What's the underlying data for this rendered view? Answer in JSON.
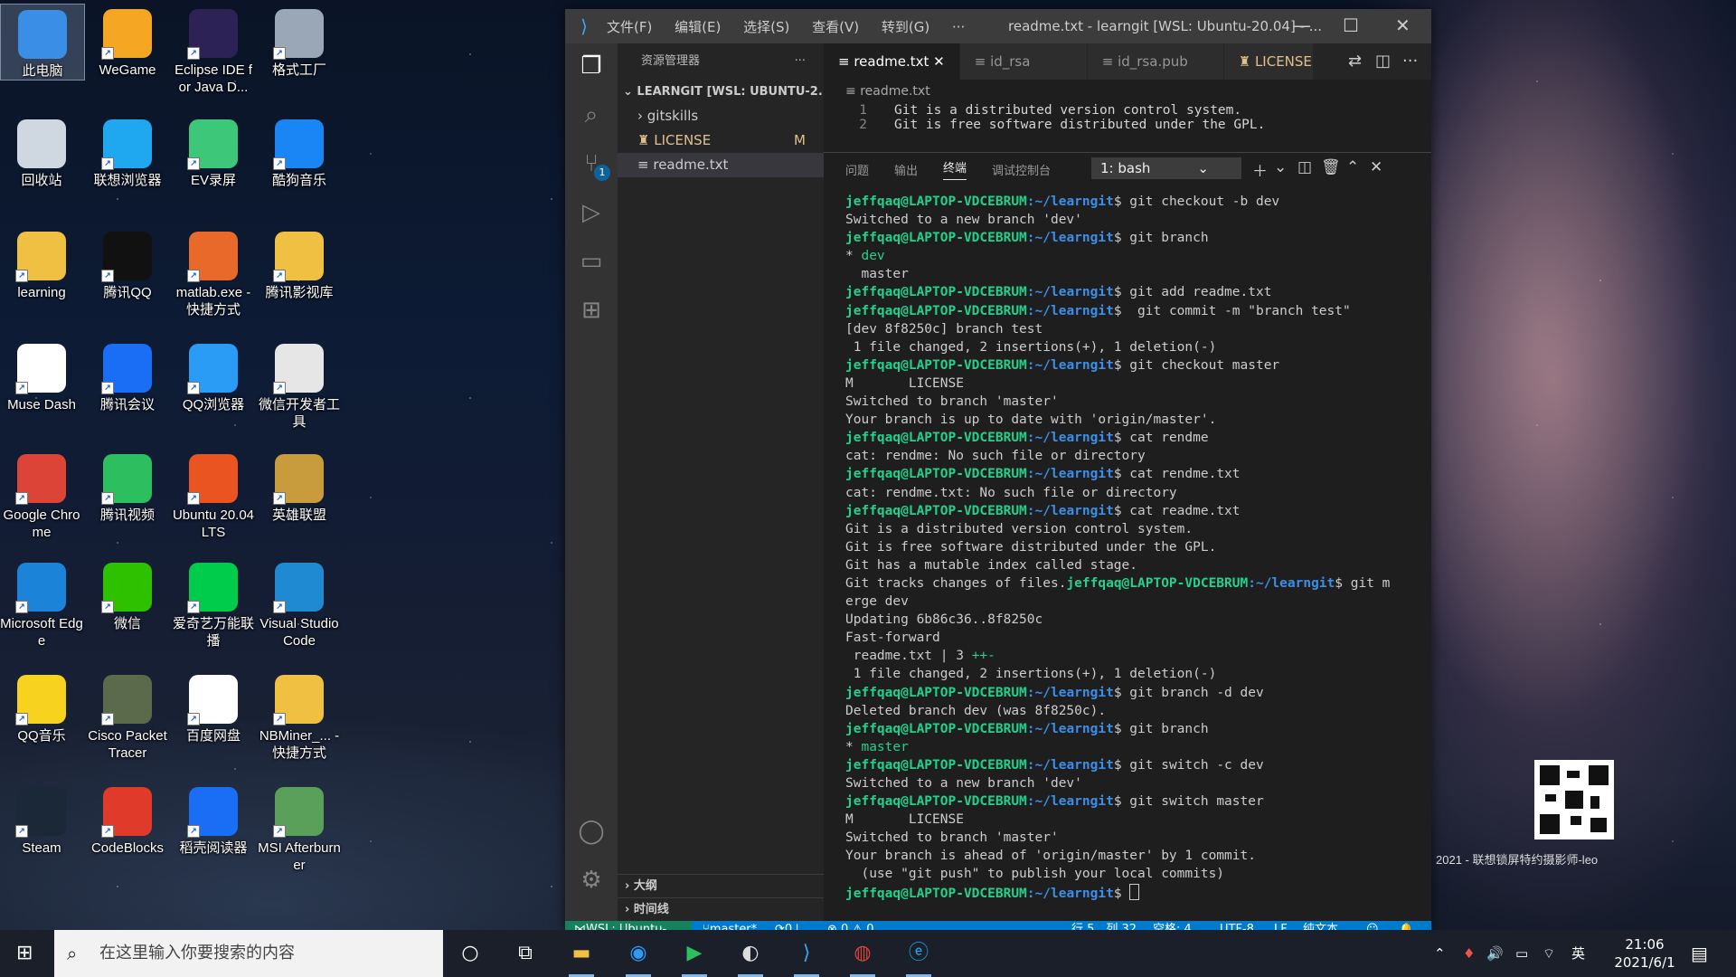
{
  "desktop": {
    "icons": [
      {
        "label": "此电脑",
        "icon": "computer-icon",
        "color": "#3a8ee6"
      },
      {
        "label": "WeGame",
        "icon": "wegame-icon",
        "color": "#f5a623"
      },
      {
        "label": "Eclipse IDE for Java D...",
        "icon": "eclipse-icon",
        "color": "#2c2255"
      },
      {
        "label": "格式工厂",
        "icon": "format-factory-icon",
        "color": "#9aa7b6"
      },
      {
        "label": "回收站",
        "icon": "recycle-bin-icon",
        "color": "#cfd8e0"
      },
      {
        "label": "联想浏览器",
        "icon": "lenovo-browser-icon",
        "color": "#1fa8f0"
      },
      {
        "label": "EV录屏",
        "icon": "ev-recorder-icon",
        "color": "#3cc878"
      },
      {
        "label": "酷狗音乐",
        "icon": "kugou-icon",
        "color": "#1a86f5"
      },
      {
        "label": "learning",
        "icon": "folder-icon",
        "color": "#f0c043"
      },
      {
        "label": "腾讯QQ",
        "icon": "qq-icon",
        "color": "#111111"
      },
      {
        "label": "matlab.exe - 快捷方式",
        "icon": "matlab-icon",
        "color": "#e8692a"
      },
      {
        "label": "腾讯影视库",
        "icon": "folder-video-icon",
        "color": "#f0c043"
      },
      {
        "label": "Muse Dash",
        "icon": "file-icon",
        "color": "#ffffff"
      },
      {
        "label": "腾讯会议",
        "icon": "tencent-meeting-icon",
        "color": "#1a6ef5"
      },
      {
        "label": "QQ浏览器",
        "icon": "qq-browser-icon",
        "color": "#2a9cf5"
      },
      {
        "label": "微信开发者工具",
        "icon": "wechat-devtools-icon",
        "color": "#e6e6e6"
      },
      {
        "label": "Google Chrome",
        "icon": "chrome-icon",
        "color": "#db4437"
      },
      {
        "label": "腾讯视频",
        "icon": "tencent-video-icon",
        "color": "#2dbe60"
      },
      {
        "label": "Ubuntu 20.04 LTS",
        "icon": "ubuntu-icon",
        "color": "#e95420"
      },
      {
        "label": "英雄联盟",
        "icon": "league-icon",
        "color": "#c89b3c"
      },
      {
        "label": "Microsoft Edge",
        "icon": "edge-icon",
        "color": "#1b84d8"
      },
      {
        "label": "微信",
        "icon": "wechat-icon",
        "color": "#2dc100"
      },
      {
        "label": "爱奇艺万能联播",
        "icon": "iqiyi-icon",
        "color": "#00cc4c"
      },
      {
        "label": "Visual Studio Code",
        "icon": "vscode-icon",
        "color": "#1f8ad2"
      },
      {
        "label": "QQ音乐",
        "icon": "qq-music-icon",
        "color": "#f7d21e"
      },
      {
        "label": "Cisco Packet Tracer",
        "icon": "cisco-icon",
        "color": "#5a6a4a"
      },
      {
        "label": "百度网盘",
        "icon": "baidu-netdisk-icon",
        "color": "#ffffff"
      },
      {
        "label": "NBMiner_... - 快捷方式",
        "icon": "folder-icon",
        "color": "#f0c043"
      },
      {
        "label": "Steam",
        "icon": "steam-icon",
        "color": "#1b2838"
      },
      {
        "label": "CodeBlocks",
        "icon": "codeblocks-icon",
        "color": "#e03a2a"
      },
      {
        "label": "稻壳阅读器",
        "icon": "docer-reader-icon",
        "color": "#1a6ef5"
      },
      {
        "label": "MSI Afterburner",
        "icon": "msi-afterburner-icon",
        "color": "#5aa05a"
      }
    ],
    "watermark": "2021 - 联想锁屏特约摄影师-leo"
  },
  "vscode": {
    "menu": [
      "文件(F)",
      "编辑(E)",
      "选择(S)",
      "查看(V)",
      "转到(G)",
      "···"
    ],
    "title": "readme.txt - learngit [WSL: Ubuntu-20.04] - ...",
    "explorer": {
      "header": "资源管理器",
      "more": "···",
      "folder": "LEARNGIT [WSL: UBUNTU-2...",
      "items": [
        {
          "label": "gitskills",
          "type": "folder"
        },
        {
          "label": "LICENSE",
          "type": "modified",
          "status": "M"
        },
        {
          "label": "readme.txt",
          "type": "active"
        }
      ],
      "outline": "大纲",
      "timeline": "时间线"
    },
    "scm_badge": "1",
    "tabs": [
      {
        "label": "readme.txt",
        "active": true
      },
      {
        "label": "id_rsa",
        "active": false
      },
      {
        "label": "id_rsa.pub",
        "active": false
      },
      {
        "label": "LICENSE",
        "active": false
      }
    ],
    "breadcrumb": "readme.txt",
    "code_lines": [
      {
        "num": "1",
        "text": "Git is a distributed version control system."
      },
      {
        "num": "2",
        "text": "Git is free software distributed under the GPL."
      }
    ],
    "panel": {
      "tabs": [
        "问题",
        "输出",
        "终端",
        "调试控制台"
      ],
      "active_tab": "终端",
      "terminal_select": "1: bash"
    },
    "terminal_lines": [
      {
        "prompt": true,
        "cmd": " git checkout -b dev"
      },
      {
        "text": "Switched to a new branch 'dev'"
      },
      {
        "prompt": true,
        "cmd": " git branch"
      },
      {
        "text": "* ",
        "green": "dev"
      },
      {
        "text": "  master"
      },
      {
        "prompt": true,
        "cmd": " git add readme.txt"
      },
      {
        "prompt": true,
        "cmd": "  git commit -m \"branch test\""
      },
      {
        "text": "[dev 8f8250c] branch test"
      },
      {
        "text": " 1 file changed, 2 insertions(+), 1 deletion(-)"
      },
      {
        "prompt": true,
        "cmd": " git checkout master"
      },
      {
        "text": "M       LICENSE"
      },
      {
        "text": "Switched to branch 'master'"
      },
      {
        "text": "Your branch is up to date with 'origin/master'."
      },
      {
        "prompt": true,
        "cmd": " cat rendme"
      },
      {
        "text": "cat: rendme: No such file or directory"
      },
      {
        "prompt": true,
        "cmd": " cat rendme.txt"
      },
      {
        "text": "cat: rendme.txt: No such file or directory"
      },
      {
        "prompt": true,
        "cmd": " cat readme.txt"
      },
      {
        "text": "Git is a distributed version control system."
      },
      {
        "text": "Git is free software distributed under the GPL."
      },
      {
        "text": "Git has a mutable index called stage."
      },
      {
        "text": "Git tracks changes of files.",
        "prompt_after": true,
        "cmd": " git m"
      },
      {
        "text": "erge dev"
      },
      {
        "text": "Updating 6b86c36..8f8250c"
      },
      {
        "text": "Fast-forward"
      },
      {
        "text": " readme.txt | 3 ",
        "green": "++-"
      },
      {
        "text": " 1 file changed, 2 insertions(+), 1 deletion(-)"
      },
      {
        "prompt": true,
        "cmd": " git branch -d dev"
      },
      {
        "text": "Deleted branch dev (was 8f8250c)."
      },
      {
        "prompt": true,
        "cmd": " git branch"
      },
      {
        "text": "* ",
        "green": "master"
      },
      {
        "prompt": true,
        "cmd": " git switch -c dev"
      },
      {
        "text": "Switched to a new branch 'dev'"
      },
      {
        "prompt": true,
        "cmd": " git switch master"
      },
      {
        "text": "M       LICENSE"
      },
      {
        "text": "Switched to branch 'master'"
      },
      {
        "text": "Your branch is ahead of 'origin/master' by 1 commit."
      },
      {
        "text": "  (use \"git push\" to publish your local commits)"
      },
      {
        "prompt": true,
        "cmd": " ",
        "cursor": true
      }
    ],
    "prompt_user": "jeffqaq@LAPTOP-VDCEBRUM",
    "prompt_path": ":~/learngit",
    "prompt_sigil": "$",
    "statusbar": {
      "remote": "WSL: Ubuntu-20.04",
      "branch": "master*",
      "sync": "0↓ 1↑",
      "problems": "⊗ 0 ⚠ 0",
      "position": "行 5，列 32",
      "spaces": "空格: 4",
      "encoding": "UTF-8",
      "eol": "LF",
      "language": "纯文本"
    }
  },
  "taskbar": {
    "search_placeholder": "在这里输入你要搜索的内容",
    "ime": "英",
    "time": "21:06",
    "date": "2021/6/1"
  }
}
